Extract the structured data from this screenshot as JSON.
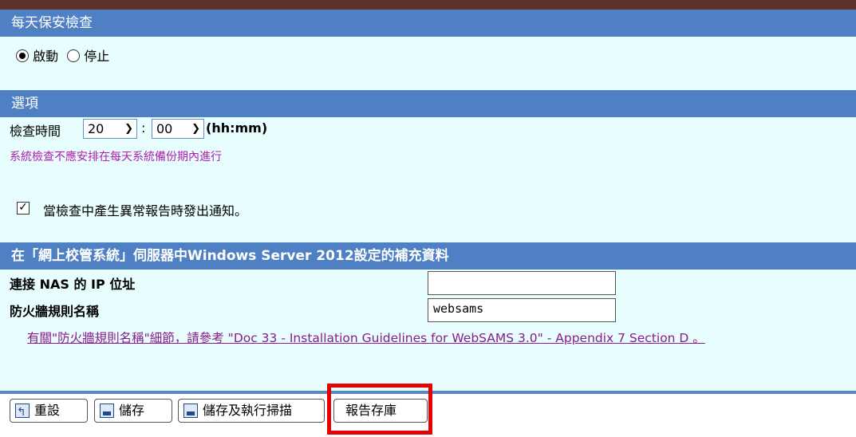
{
  "sections": {
    "daily_check": {
      "title": "每天保安檢查"
    },
    "options": {
      "title": "選項"
    },
    "windows_info": {
      "title": "在「網上校管系統」伺服器中Windows Server 2012設定的補充資料"
    }
  },
  "daily_check": {
    "enable_label": "啟動",
    "disable_label": "停止",
    "selected": "啟動"
  },
  "options": {
    "check_time_label": "檢查時間",
    "hour": "20",
    "minute": "00",
    "separator": ":",
    "format_label": "(hh:mm)",
    "backup_note": "系統檢查不應安排在每天系統備份期內進行",
    "notify_label": "當檢查中產生異常報告時發出通知。",
    "notify_checked": true
  },
  "windows_info": {
    "nas_ip_label": "連接 NAS 的 IP 位址",
    "nas_ip_value": "",
    "firewall_label": "防火牆規則名稱",
    "firewall_value": "websams",
    "reference_link": "有關\"防火牆規則名稱\"細節，請參考 \"Doc 33 - Installation Guidelines for WebSAMS 3.0\" - Appendix 7 Section D 。"
  },
  "toolbar": {
    "reset_label": "重設",
    "save_label": "儲存",
    "save_run_label": "儲存及執行掃描",
    "report_label": "報告存庫"
  },
  "colors": {
    "header_bg": "#4f80c4",
    "content_bg": "#e8fdfd",
    "note_color": "#b020b0",
    "link_color": "#8a1d8c",
    "highlight": "#e60000"
  }
}
